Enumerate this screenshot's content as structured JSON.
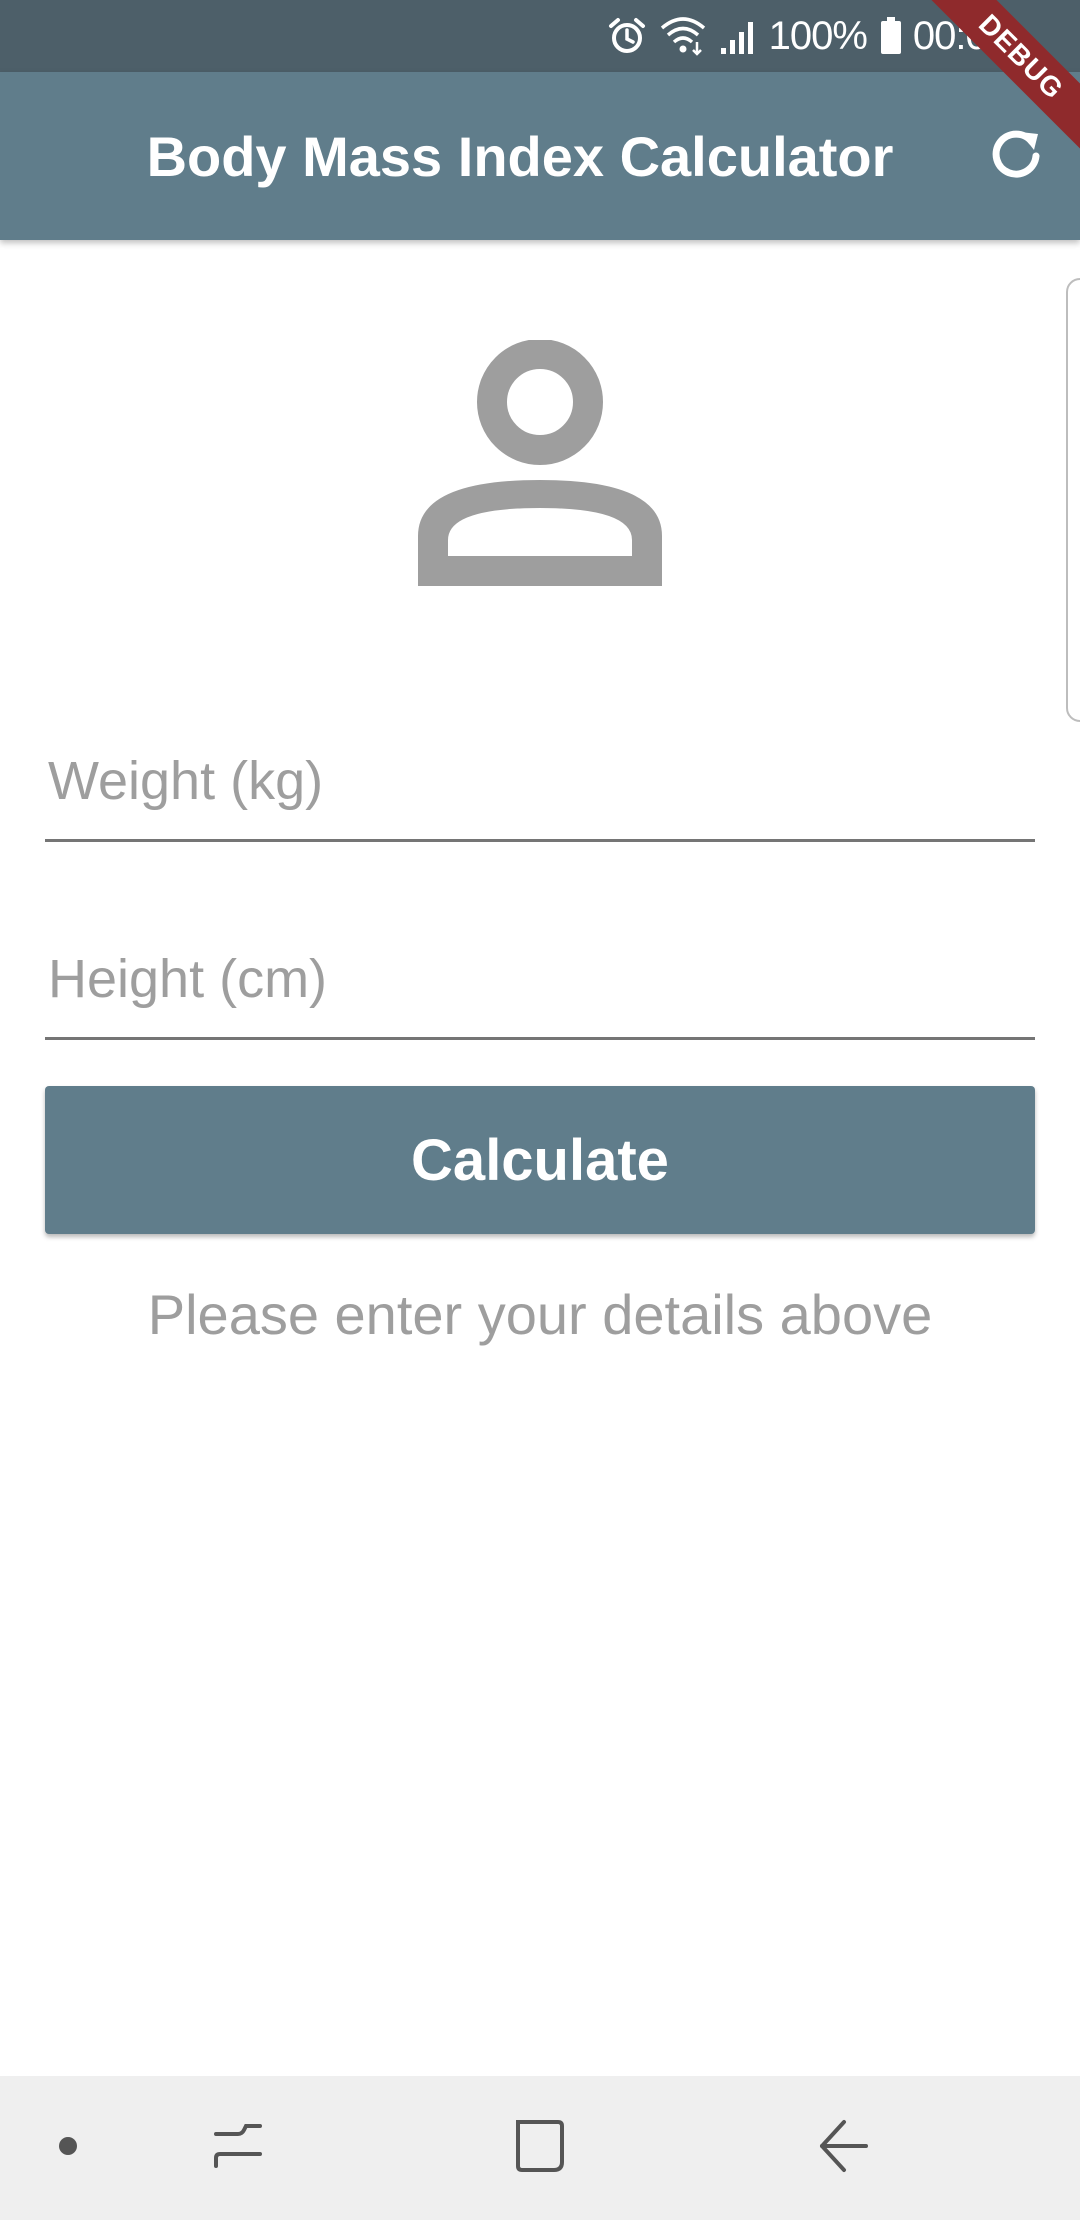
{
  "status_bar": {
    "battery_text": "100%",
    "time": "00:07",
    "icons": [
      "alarm-icon",
      "wifi-icon",
      "signal-icon",
      "battery-icon"
    ]
  },
  "debug_banner": {
    "label": "DEBUG"
  },
  "app_bar": {
    "title": "Body Mass Index Calculator",
    "action_icon": "refresh-icon"
  },
  "avatar": {
    "icon": "person-icon"
  },
  "form": {
    "weight": {
      "placeholder": "Weight (kg)",
      "value": ""
    },
    "height": {
      "placeholder": "Height (cm)",
      "value": ""
    },
    "calculate_label": "Calculate"
  },
  "result": {
    "message": "Please enter your details above"
  },
  "nav_bar": {
    "items": [
      "dot-icon",
      "recents-icon",
      "home-icon",
      "back-icon"
    ]
  },
  "colors": {
    "primary": "#607d8b",
    "status_bar": "#4d5f69",
    "hint_grey": "#9e9e9e",
    "debug_red": "#8f2a2c"
  }
}
